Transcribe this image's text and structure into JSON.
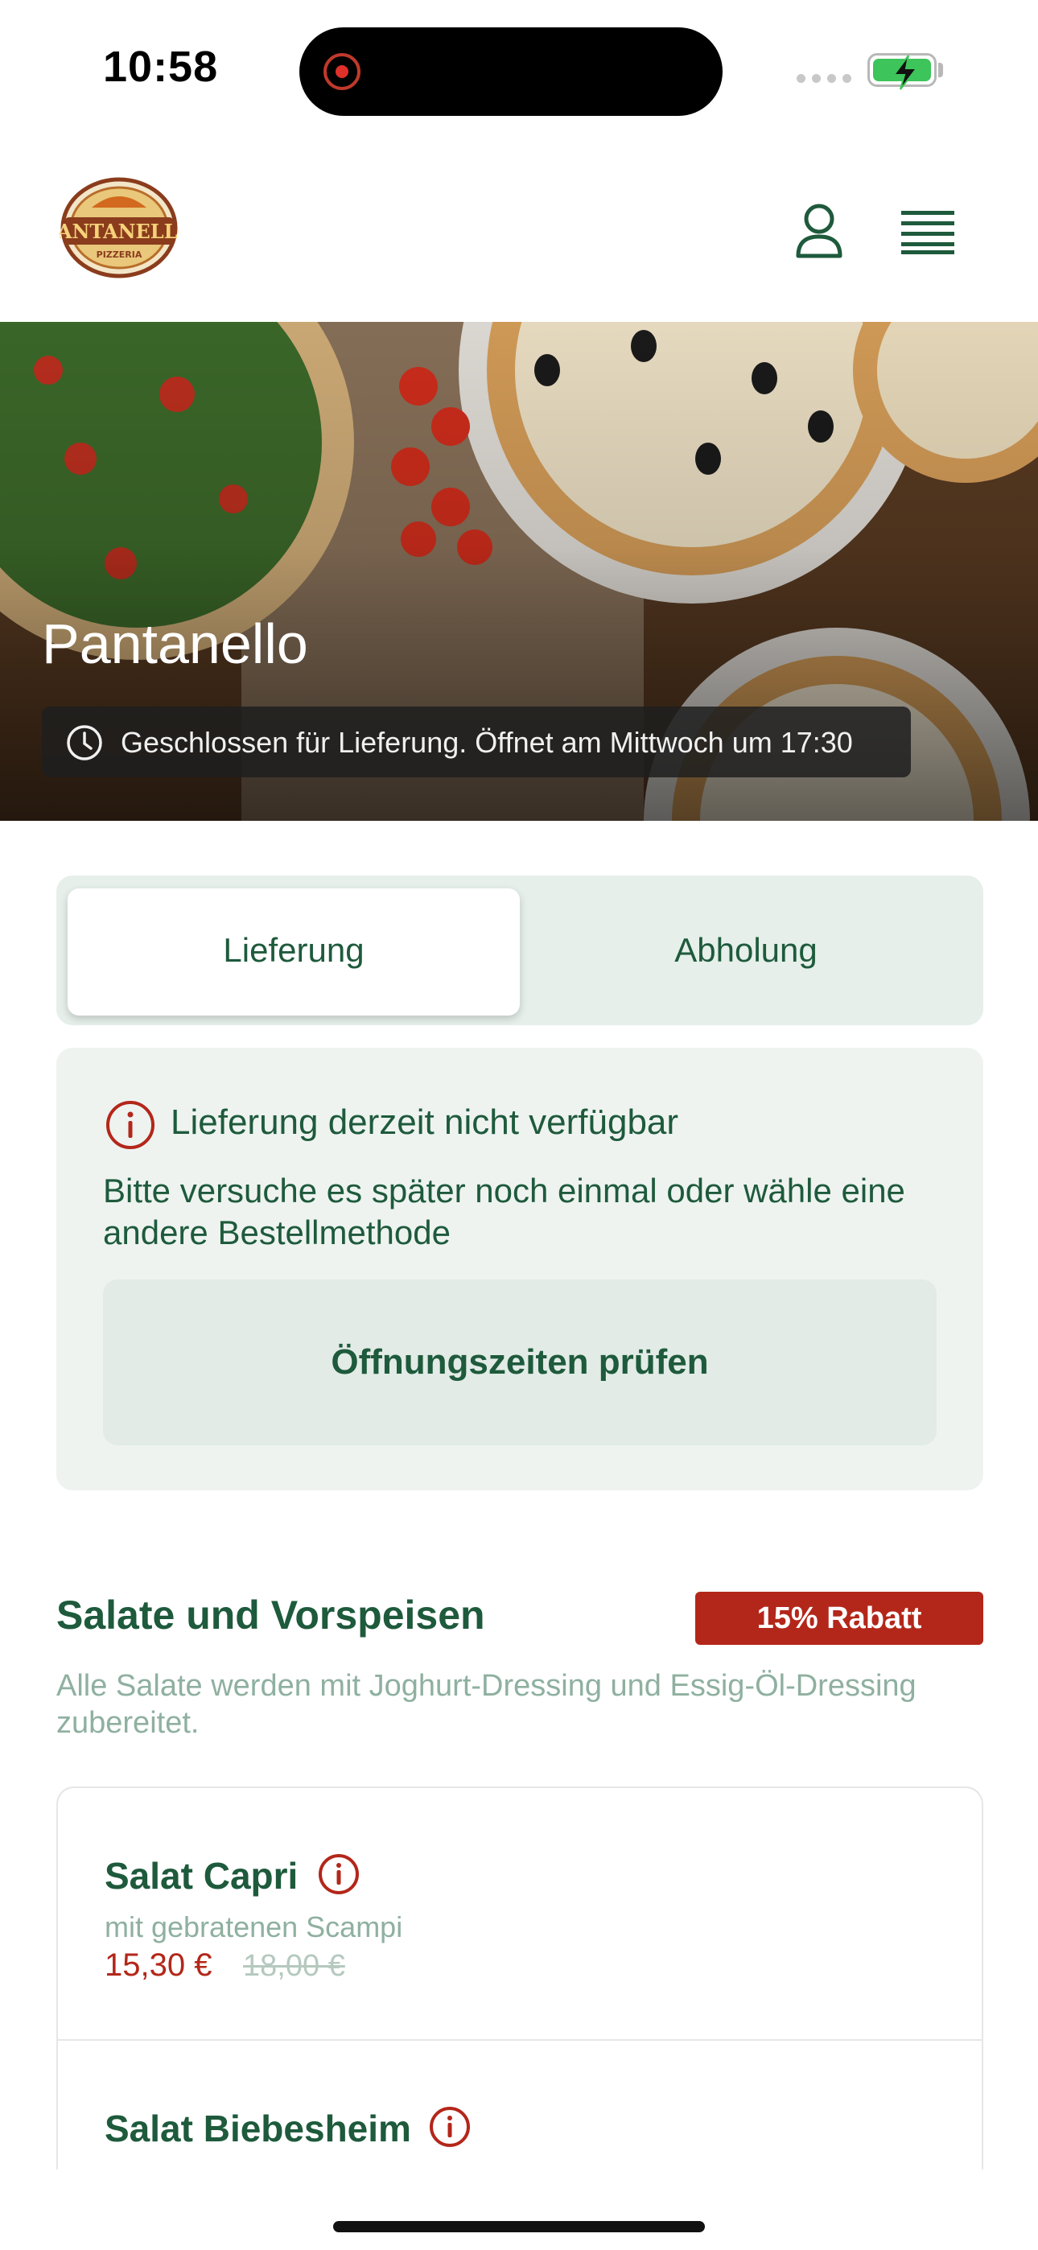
{
  "status_bar": {
    "time": "10:58"
  },
  "header": {
    "logo_alt": "PANTANELLO",
    "logo_sub": "PIZZERIA"
  },
  "hero": {
    "title": "Pantanello",
    "closed_message": "Geschlossen für Lieferung. Öffnet am Mittwoch um 17:30"
  },
  "order_mode": {
    "options": [
      "Lieferung",
      "Abholung"
    ],
    "selected": "Lieferung"
  },
  "notice": {
    "title": "Lieferung derzeit nicht verfügbar",
    "body": "Bitte versuche es später noch einmal oder wähle eine andere Bestellmethode",
    "button_label": "Öffnungszeiten prüfen"
  },
  "section": {
    "title": "Salate und Vorspeisen",
    "badge": "15% Rabatt",
    "description": "Alle Salate werden mit Joghurt-Dressing und Essig-Öl-Dressing zubereitet."
  },
  "items": [
    {
      "name": "Salat Capri",
      "description": "mit gebratenen Scampi",
      "price": "15,30 €",
      "old_price": "18,00 €"
    },
    {
      "name": "Salat Biebesheim"
    }
  ],
  "colors": {
    "brand_green": "#1e5a3c",
    "accent_red": "#b3271a",
    "muted_green": "#8fb0a0",
    "surface": "#eef3f0"
  }
}
